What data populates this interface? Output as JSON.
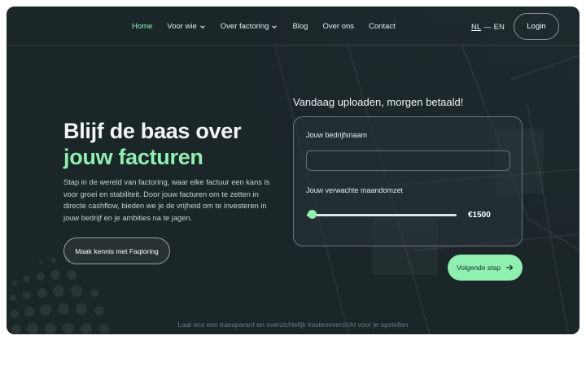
{
  "nav": {
    "items": [
      {
        "label": "Home",
        "active": true,
        "dropdown": false
      },
      {
        "label": "Voor wie",
        "active": false,
        "dropdown": true
      },
      {
        "label": "Over factoring",
        "active": false,
        "dropdown": true
      },
      {
        "label": "Blog",
        "active": false,
        "dropdown": false
      },
      {
        "label": "Over ons",
        "active": false,
        "dropdown": false
      },
      {
        "label": "Contact",
        "active": false,
        "dropdown": false
      }
    ],
    "lang_nl": "NL",
    "lang_sep": "—",
    "lang_en": "EN",
    "login": "Login"
  },
  "hero": {
    "title_line1": "Blijf de baas over",
    "title_line2": "jouw facturen",
    "text": "Stap in de wereld van factoring, waar elke factuur een kans is voor groei en stabiliteit. Door jouw facturen om te zetten in directe cashflow, bieden we je de vrijheid om te investeren in jouw bedrijf en je ambities na te jagen.",
    "cta": "Maak kennis met Faqtoring"
  },
  "form": {
    "heading": "Vandaag uploaden, morgen betaald!",
    "company_label": "Jouw bedrijfsnaam",
    "company_value": "",
    "revenue_label": "Jouw verwachte maandomzet",
    "revenue_value": "€1500",
    "next": "Volgende stap"
  },
  "footer": {
    "text": "Laat ons een transparant en overzichtelijk kostenoverzicht voor je opstellen"
  },
  "colors": {
    "accent": "#8ff0b0",
    "background": "#1a2528",
    "text": "#f2f5f5"
  }
}
